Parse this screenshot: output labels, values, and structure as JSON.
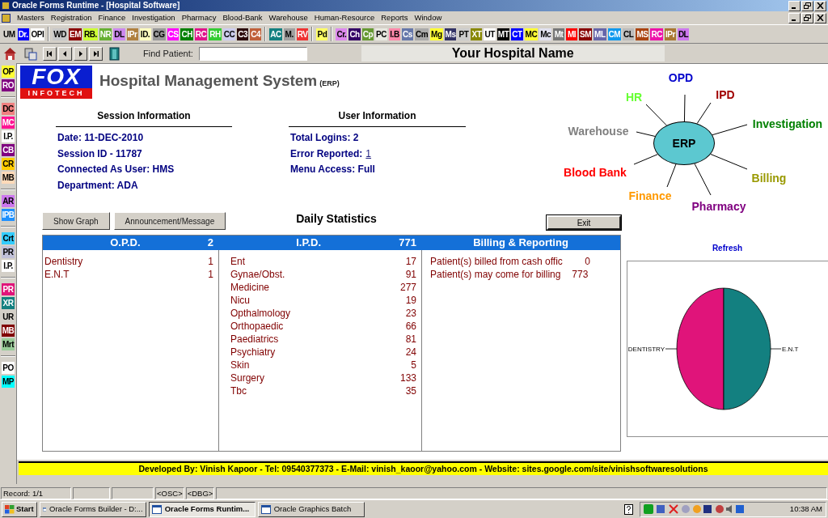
{
  "window": {
    "title": "Oracle Forms Runtime - [Hospital Software]"
  },
  "menu": [
    "Masters",
    "Registration",
    "Finance",
    "Investigation",
    "Pharmacy",
    "Blood-Bank",
    "Warehouse",
    "Human-Resource",
    "Reports",
    "Window"
  ],
  "toolbar": {
    "groups": [
      [
        {
          "label": "UM",
          "color": "#d4d0c8"
        },
        {
          "label": "Dr.",
          "color": "#0000ff"
        },
        {
          "label": "OPI",
          "color": "#ffffff"
        }
      ],
      [
        {
          "label": "WD",
          "color": "#c8c8c8"
        },
        {
          "label": "EM",
          "color": "#8b0000"
        },
        {
          "label": "RB.",
          "color": "#ccff33"
        },
        {
          "label": "NR",
          "color": "#66b033"
        },
        {
          "label": "DL",
          "color": "#cc88ee"
        },
        {
          "label": "IPr",
          "color": "#b08040"
        },
        {
          "label": "ID.",
          "color": "#ffffc0"
        },
        {
          "label": "CG",
          "color": "#999999"
        },
        {
          "label": "CS",
          "color": "#ff00ff"
        },
        {
          "label": "CH",
          "color": "#008000"
        },
        {
          "label": "RC",
          "color": "#e0148c"
        },
        {
          "label": "RH",
          "color": "#33cc33"
        },
        {
          "label": "CC",
          "color": "#ccccee"
        },
        {
          "label": "C3",
          "color": "#2a0a0a"
        },
        {
          "label": "C4",
          "color": "#c0603a"
        }
      ],
      [
        {
          "label": "AC",
          "color": "#138080"
        },
        {
          "label": "M.",
          "color": "#a0a0a0"
        },
        {
          "label": "RV",
          "color": "#ee3333"
        }
      ],
      [
        {
          "label": "Pd",
          "color": "#ffff66"
        }
      ],
      [
        {
          "label": "Cr.",
          "color": "#dd88ee"
        },
        {
          "label": "Ch",
          "color": "#330066"
        },
        {
          "label": "Cp",
          "color": "#669933"
        },
        {
          "label": "PC",
          "color": "#e8e8e0"
        },
        {
          "label": "I.B",
          "color": "#ff88aa"
        },
        {
          "label": "Cs",
          "color": "#6677aa"
        },
        {
          "label": "Cm",
          "color": "#aaaaaa"
        },
        {
          "label": "Mg",
          "color": "#ffff33"
        },
        {
          "label": "Ms",
          "color": "#333366"
        },
        {
          "label": "PT",
          "color": "#cccccc"
        },
        {
          "label": "XT",
          "color": "#888800"
        },
        {
          "label": "UT",
          "color": "#ffffff"
        },
        {
          "label": "MT",
          "color": "#000000"
        },
        {
          "label": "CT",
          "color": "#0000ff"
        },
        {
          "label": "MC",
          "color": "#ffff33"
        },
        {
          "label": "Mc",
          "color": "#e0e0ee"
        },
        {
          "label": "Mt",
          "color": "#777777"
        },
        {
          "label": "MI",
          "color": "#ff0000"
        },
        {
          "label": "SM",
          "color": "#880000"
        },
        {
          "label": "ML",
          "color": "#6666aa"
        },
        {
          "label": "CM",
          "color": "#1199ee"
        },
        {
          "label": "CL",
          "color": "#bbbbbb"
        },
        {
          "label": "MS",
          "color": "#aa4411"
        },
        {
          "label": "RC",
          "color": "#ee11aa"
        },
        {
          "label": "IPr",
          "color": "#aa7733"
        },
        {
          "label": "DL",
          "color": "#cc77ee"
        }
      ]
    ]
  },
  "find_patient": {
    "label": "Find Patient:"
  },
  "hospital_name": "Your Hospital Name",
  "sidebar": {
    "groups": [
      [
        {
          "label": "OP",
          "color": "#ffff33"
        },
        {
          "label": "RO",
          "color": "#800080"
        }
      ],
      [
        {
          "label": "DC",
          "color": "#f08080"
        },
        {
          "label": "MC",
          "color": "#ff1493"
        },
        {
          "label": "I.P.",
          "color": "#ffffff"
        },
        {
          "label": "CB",
          "color": "#800080"
        },
        {
          "label": "CR",
          "color": "#ffcc00"
        },
        {
          "label": "MB",
          "color": "#ffdab9"
        }
      ],
      [
        {
          "label": "AR",
          "color": "#cc77ee"
        },
        {
          "label": "IPB",
          "color": "#1e90ff"
        }
      ],
      [
        {
          "label": "Crt",
          "color": "#33ccff"
        },
        {
          "label": "PR",
          "color": "#c0c0d8"
        },
        {
          "label": "I.P.",
          "color": "#ffffff"
        }
      ],
      [
        {
          "label": "PR",
          "color": "#e0147a"
        },
        {
          "label": "XR",
          "color": "#138080"
        },
        {
          "label": "UR",
          "color": "#d4d0c8"
        },
        {
          "label": "MB",
          "color": "#800000"
        },
        {
          "label": "Mrt",
          "color": "#99cc99"
        }
      ],
      [
        {
          "label": "PO",
          "color": "#ffffff"
        },
        {
          "label": "MP",
          "color": "#00ffff"
        }
      ]
    ]
  },
  "logo": {
    "top": "FOX",
    "bottom": "INFOTECH"
  },
  "app_title": {
    "main": "Hospital Management System",
    "suffix": "(ERP)"
  },
  "session": {
    "title": "Session Information",
    "rows": [
      "Date: 11-DEC-2010",
      "Session ID - 11787",
      "Connected As User: HMS",
      "Department: ADA"
    ]
  },
  "user": {
    "title": "User Information",
    "rows": [
      {
        "label": "Total Logins: 2"
      },
      {
        "label": "Error Reported:",
        "link": "1"
      },
      {
        "label": "Menu Access: Full"
      }
    ]
  },
  "erp": {
    "center": "ERP",
    "modules": [
      {
        "label": "OPD",
        "color": "#0000cc"
      },
      {
        "label": "IPD",
        "color": "#a00000"
      },
      {
        "label": "Investigation",
        "color": "#008000"
      },
      {
        "label": "Billing",
        "color": "#999900"
      },
      {
        "label": "Pharmacy",
        "color": "#800080"
      },
      {
        "label": "Finance",
        "color": "#ff9900"
      },
      {
        "label": "Blood Bank",
        "color": "#ff0000"
      },
      {
        "label": "Warehouse",
        "color": "#808080"
      },
      {
        "label": "HR",
        "color": "#66ff33"
      }
    ]
  },
  "buttons": [
    "Show Graph",
    "Announcement/Message"
  ],
  "daily_title": "Daily Statistics",
  "exit_button": "Exit",
  "stats": [
    {
      "title": "O.P.D.",
      "total": "2",
      "rows": [
        {
          "name": "Dentistry",
          "value": "1"
        },
        {
          "name": "E.N.T",
          "value": "1"
        }
      ]
    },
    {
      "title": "I.P.D.",
      "total": "771",
      "rows": [
        {
          "name": "Ent",
          "value": "17"
        },
        {
          "name": "Gynae/Obst.",
          "value": "91"
        },
        {
          "name": "Medicine",
          "value": "277"
        },
        {
          "name": "Nicu",
          "value": "19"
        },
        {
          "name": "Opthalmology",
          "value": "23"
        },
        {
          "name": "Orthopaedic",
          "value": "66"
        },
        {
          "name": "Paediatrics",
          "value": "81"
        },
        {
          "name": "Psychiatry",
          "value": "24"
        },
        {
          "name": "Skin",
          "value": "5"
        },
        {
          "name": "Surgery",
          "value": "133"
        },
        {
          "name": "Tbc",
          "value": "35"
        }
      ]
    },
    {
      "title": "Billing & Reporting",
      "rows": [
        {
          "name": "Patient(s) billed from cash offic",
          "value": "0"
        },
        {
          "name": "Patient(s) may come for billing",
          "value": "773"
        }
      ]
    }
  ],
  "graph": {
    "refresh": "Refresh",
    "labels": [
      "DENTISTRY",
      "E.N.T"
    ]
  },
  "footer": "Developed By: Vinish Kapoor - Tel: 09540377373 - E-Mail: vinish_kaoor@yahoo.com - Website: sites.google.com/site/vinishsoftwaresolutions",
  "status_bar": {
    "record": "Record: 1/1",
    "osc": "<OSC>",
    "dbg": "<DBG>"
  },
  "taskbar": {
    "start": "Start",
    "tasks": [
      {
        "label": "Oracle Forms Builder - D:...",
        "selected": false
      },
      {
        "label": "Oracle Forms Runtim...",
        "selected": true
      },
      {
        "label": "Oracle Graphics Batch",
        "selected": false
      }
    ],
    "clock": "10:38 AM"
  }
}
